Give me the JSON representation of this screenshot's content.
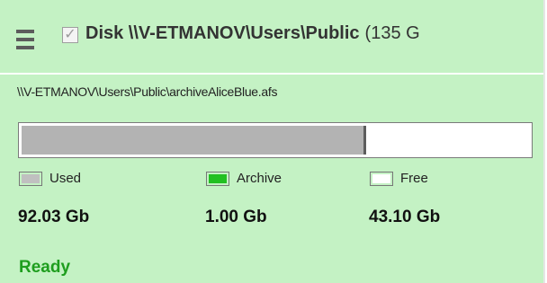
{
  "header": {
    "title_bold": "Disk \\\\V-ETMANOV\\Users\\Public",
    "title_size": "(135 G"
  },
  "archive_path": "\\\\V-ETMANOV\\Users\\Public\\archiveAliceBlue.afs",
  "usage": {
    "used_fraction": 0.6795,
    "archive_fraction": 0.0,
    "colors": {
      "used": "#c0c0c0",
      "archive": "#22c022",
      "free": "#ffffff"
    }
  },
  "legend": {
    "used_label": "Used",
    "archive_label": "Archive",
    "free_label": "Free"
  },
  "values": {
    "used": "92.03 Gb",
    "archive": "1.00 Gb",
    "free": "43.10 Gb"
  },
  "status": "Ready"
}
